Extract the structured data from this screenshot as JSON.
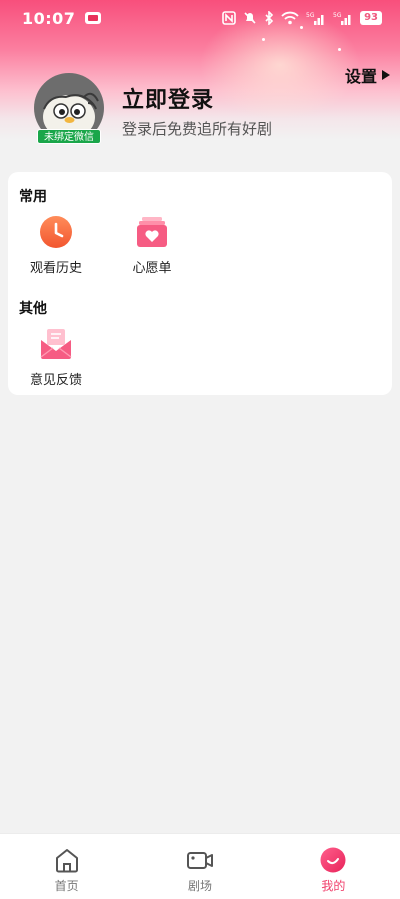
{
  "status_bar": {
    "time": "10:07",
    "battery": "93",
    "signal_1_label": "5G",
    "signal_2_label": "5G"
  },
  "header": {
    "settings_label": "设置",
    "login_title": "立即登录",
    "login_subtitle": "登录后免费追所有好剧",
    "wechat_badge": "未绑定微信"
  },
  "common_section": {
    "title": "常用",
    "items": [
      {
        "label": "观看历史",
        "icon": "clock-icon"
      },
      {
        "label": "心愿单",
        "icon": "heart-folder-icon"
      }
    ]
  },
  "other_section": {
    "title": "其他",
    "items": [
      {
        "label": "意见反馈",
        "icon": "envelope-icon"
      }
    ]
  },
  "bottom_nav": {
    "items": [
      {
        "label": "首页",
        "icon": "home-icon",
        "active": false
      },
      {
        "label": "剧场",
        "icon": "video-camera-icon",
        "active": false
      },
      {
        "label": "我的",
        "icon": "profile-circle-icon",
        "active": true
      }
    ]
  },
  "colors": {
    "accent": "#f03e6a",
    "header_gradient_top": "#f84f7c",
    "wechat_green": "#1aa64a",
    "background": "#f2f2f2"
  }
}
